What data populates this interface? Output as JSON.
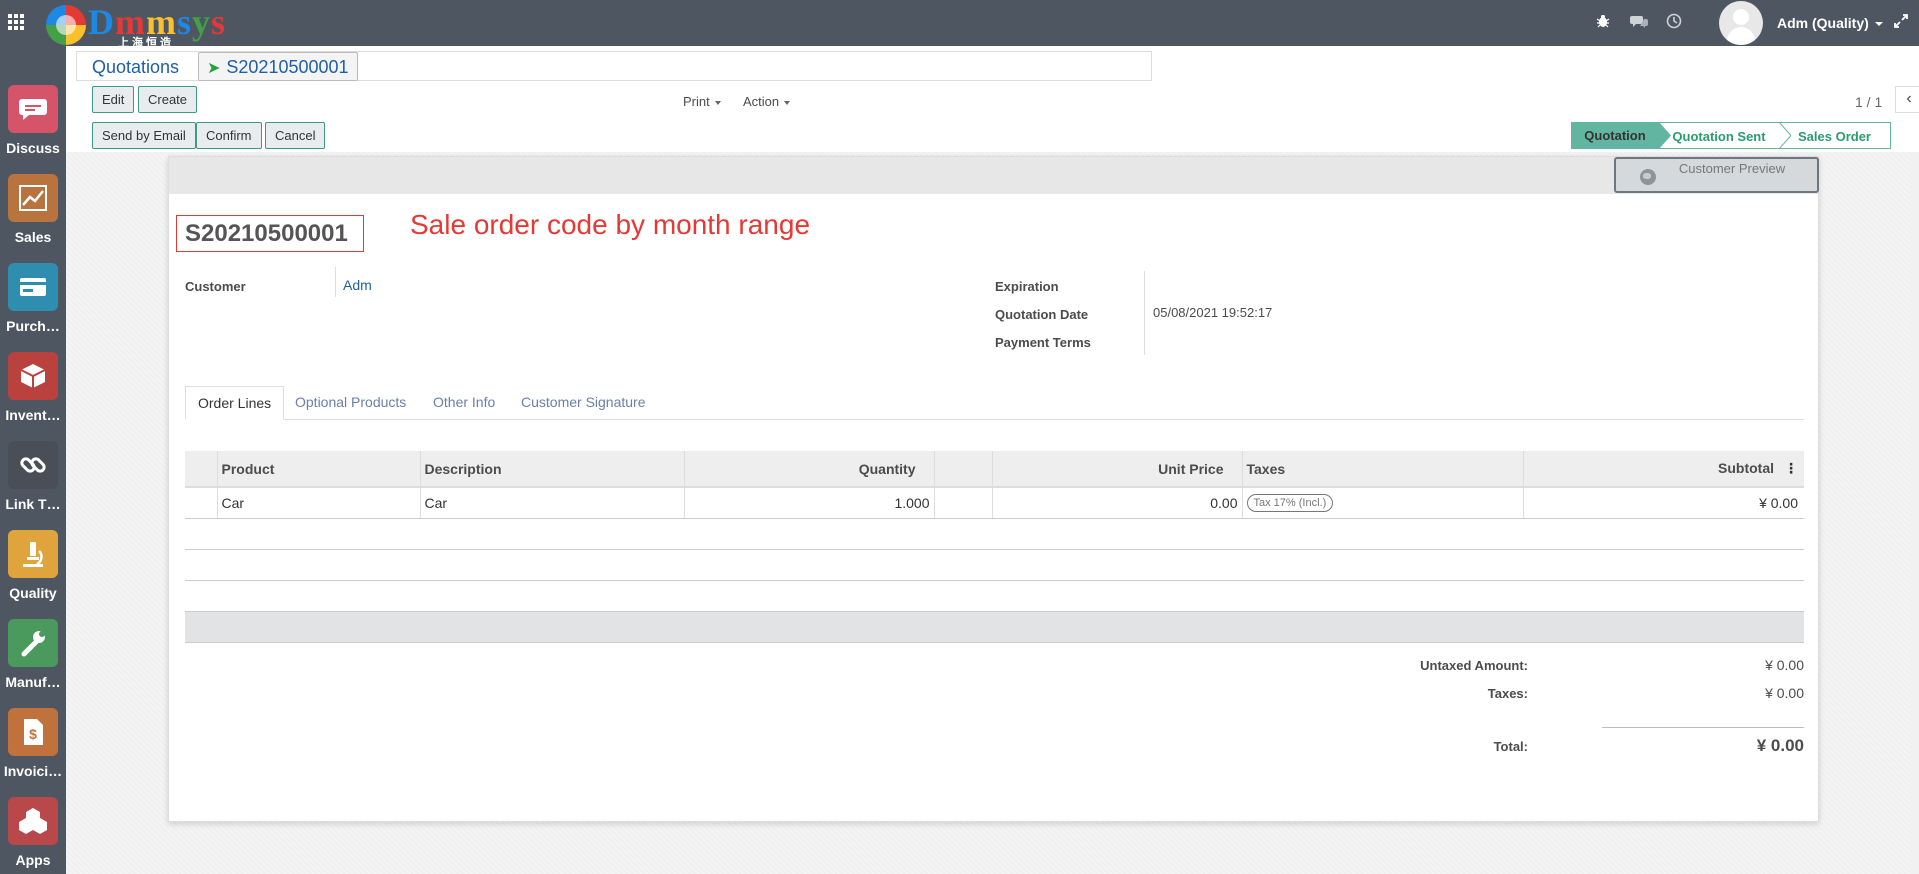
{
  "navbar": {
    "logo_text": "Dmmsys",
    "logo_sub": "上海恒造",
    "user_name": "Adm (Quality)",
    "icons": [
      "apps-grid-icon",
      "bug-icon",
      "chat-icon",
      "clock-icon",
      "expand-icon"
    ]
  },
  "sidebar": {
    "apps": [
      {
        "label": "Discuss",
        "icon": "chat-bubble-icon",
        "color": "#d5546a"
      },
      {
        "label": "Sales",
        "icon": "chart-trend-icon",
        "color": "#b8733f"
      },
      {
        "label": "Purch…",
        "icon": "credit-card-icon",
        "color": "#2f8db0"
      },
      {
        "label": "Invent…",
        "icon": "box-icon",
        "color": "#b9423f"
      },
      {
        "label": "Link T…",
        "icon": "link-icon",
        "color": "#4a4f57"
      },
      {
        "label": "Quality",
        "icon": "microscope-icon",
        "color": "#e0a43c"
      },
      {
        "label": "Manuf…",
        "icon": "wrench-icon",
        "color": "#4a9a5e"
      },
      {
        "label": "Invoici…",
        "icon": "invoice-icon",
        "color": "#c0713c"
      },
      {
        "label": "Apps",
        "icon": "cubes-icon",
        "color": "#b8484a"
      }
    ]
  },
  "breadcrumb": {
    "parent": "Quotations",
    "current": "S20210500001"
  },
  "toolbar": {
    "edit": "Edit",
    "create": "Create",
    "print": "Print",
    "action": "Action",
    "pager": "1 / 1"
  },
  "header_buttons": {
    "send_email": "Send by Email",
    "confirm": "Confirm",
    "cancel": "Cancel"
  },
  "statusbar": {
    "stages": [
      "Quotation",
      "Quotation Sent",
      "Sales Order"
    ],
    "active": "Quotation"
  },
  "sheet": {
    "preview_label": "Customer Preview",
    "order_name": "S20210500001",
    "annotation": "Sale order code by month range",
    "fields": {
      "customer_label": "Customer",
      "customer_value": "Adm",
      "expiration_label": "Expiration",
      "quotation_date_label": "Quotation Date",
      "quotation_date_value": "05/08/2021 19:52:17",
      "payment_terms_label": "Payment Terms"
    },
    "tabs": [
      "Order Lines",
      "Optional Products",
      "Other Info",
      "Customer Signature"
    ],
    "lines": {
      "columns": [
        "Product",
        "Description",
        "Quantity",
        "",
        "Unit Price",
        "Taxes",
        "Subtotal"
      ],
      "rows": [
        {
          "product": "Car",
          "description": "Car",
          "quantity": "1.000",
          "unit_price": "0.00",
          "taxes": "Tax 17% (Incl.)",
          "subtotal": "¥ 0.00"
        }
      ]
    },
    "totals": {
      "untaxed_label": "Untaxed Amount:",
      "untaxed_value": "¥ 0.00",
      "taxes_label": "Taxes:",
      "taxes_value": "¥ 0.00",
      "total_label": "Total:",
      "total_value": "¥ 0.00"
    }
  },
  "colors": {
    "navbar": "#4e5661",
    "accent": "#62b5a1",
    "link": "#1f5fa8",
    "annotation": "#e53935"
  }
}
